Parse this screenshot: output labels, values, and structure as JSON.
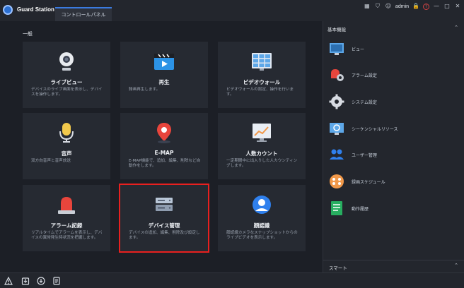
{
  "app": {
    "title": "Guard Station",
    "tab": "コントロールパネル"
  },
  "topbar": {
    "user": "admin"
  },
  "main": {
    "section_title": "一般",
    "tiles": [
      {
        "name": "ライブビュー",
        "desc": "デバイスのライブ画面を表示し、デバイスを操作します。",
        "icon": "camera-icon"
      },
      {
        "name": "再生",
        "desc": "録画再生します。",
        "icon": "playback-icon"
      },
      {
        "name": "ビデオウォール",
        "desc": "ビデオウォールの設定、操作を行います。",
        "icon": "video-wall-icon"
      },
      {
        "name": "音声",
        "desc": "双方向音声と音声放送",
        "icon": "microphone-icon"
      },
      {
        "name": "E-MAP",
        "desc": "E-MAP機能で、追加、編集、削除など自動作をします。",
        "icon": "map-pin-icon"
      },
      {
        "name": "人数カウント",
        "desc": "一定期間中に出入りした人カウンティングします。",
        "icon": "chart-icon"
      },
      {
        "name": "アラーム記録",
        "desc": "リアルタイムでアラームを表示し、デバイスの異常発生時状況を把握します。",
        "icon": "alarm-light-icon"
      },
      {
        "name": "デバイス管理",
        "desc": "デバイスの追加、編集、削除及び設定します。",
        "icon": "device-icon"
      },
      {
        "name": "顔認識",
        "desc": "顔認識カメラなスナップショットからのライブビデオを表示します。",
        "icon": "face-icon"
      }
    ]
  },
  "sidebar": {
    "title": "基本機能",
    "items": [
      {
        "label": "ビュー",
        "icon": "monitor-icon"
      },
      {
        "label": "アラーム設定",
        "icon": "alarm-gear-icon"
      },
      {
        "label": "システム設定",
        "icon": "gear-icon"
      },
      {
        "label": "シーケンシャルリソース",
        "icon": "sequence-icon"
      },
      {
        "label": "ユーザー管理",
        "icon": "users-icon"
      },
      {
        "label": "録画スケジュール",
        "icon": "schedule-icon"
      },
      {
        "label": "動作履歴",
        "icon": "log-icon"
      }
    ],
    "smart_label": "スマート"
  },
  "colors": {
    "accent": "#3a7be0",
    "selected_border": "#e8201f"
  }
}
